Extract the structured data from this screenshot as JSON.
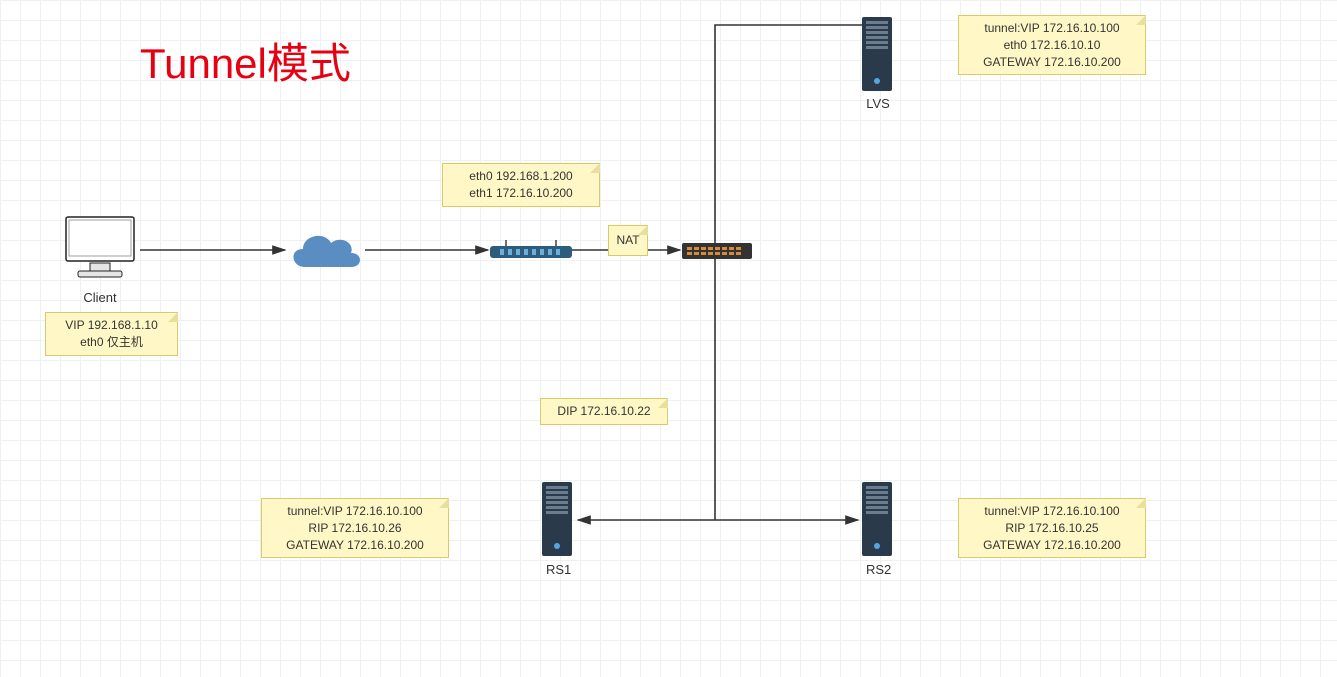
{
  "title": "Tunnel模式",
  "labels": {
    "client": "Client",
    "lvs": "LVS",
    "rs1": "RS1",
    "rs2": "RS2"
  },
  "notes": {
    "client": {
      "l1": "VIP 192.168.1.10",
      "l2": "eth0 仅主机"
    },
    "router": {
      "l1": "eth0 192.168.1.200",
      "l2": "eth1 172.16.10.200"
    },
    "nat": {
      "l1": "NAT"
    },
    "dip": {
      "l1": "DIP 172.16.10.22"
    },
    "lvs": {
      "l1": "tunnel:VIP 172.16.10.100",
      "l2": "eth0 172.16.10.10",
      "l3": "GATEWAY 172.16.10.200"
    },
    "rs1": {
      "l1": "tunnel:VIP 172.16.10.100",
      "l2": "RIP 172.16.10.26",
      "l3": "GATEWAY 172.16.10.200"
    },
    "rs2": {
      "l1": "tunnel:VIP 172.16.10.100",
      "l2": "RIP 172.16.10.25",
      "l3": "GATEWAY 172.16.10.200"
    }
  },
  "colors": {
    "line": "#333333",
    "cloud": "#4c84b7",
    "router": "#2b5a7a",
    "server": "#2b3a4a",
    "note_bg": "#fff8c6"
  },
  "connections": [
    {
      "from": "client",
      "to": "cloud"
    },
    {
      "from": "cloud",
      "to": "router"
    },
    {
      "from": "router",
      "to": "switch"
    },
    {
      "from": "switch",
      "to": "lvs"
    },
    {
      "from": "switch",
      "to": "rs1"
    },
    {
      "from": "switch",
      "to": "rs2"
    }
  ]
}
